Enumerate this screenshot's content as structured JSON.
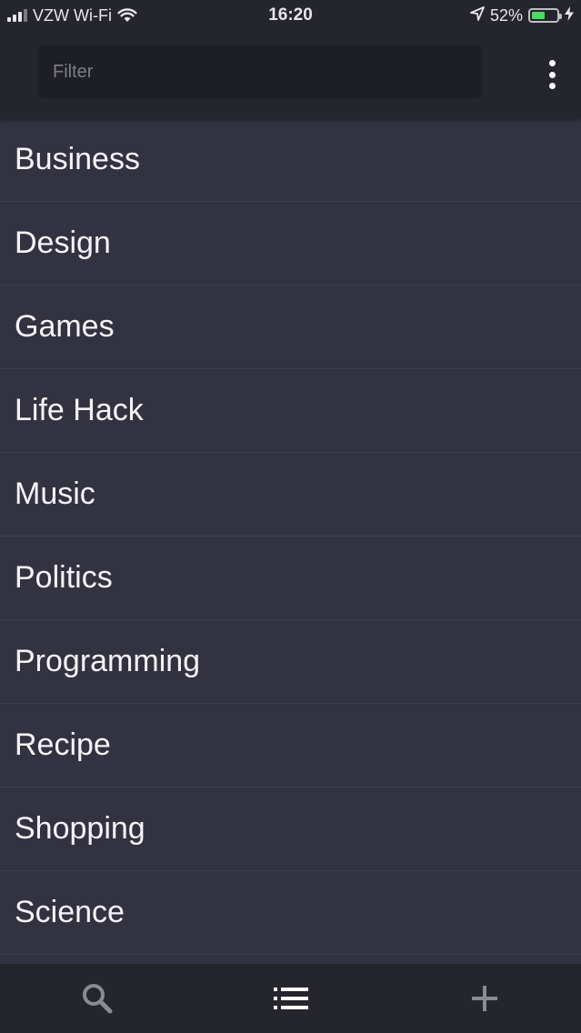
{
  "status_bar": {
    "carrier": "VZW Wi-Fi",
    "time": "16:20",
    "battery_percent": "52%",
    "battery_level": 0.52,
    "icons": [
      "signal-icon",
      "wifi-icon",
      "location-arrow-icon",
      "battery-icon",
      "charging-bolt-icon"
    ]
  },
  "header": {
    "filter_placeholder": "Filter",
    "filter_value": "",
    "menu_icon": "more-vertical-icon"
  },
  "categories": [
    {
      "label": "Business"
    },
    {
      "label": "Design"
    },
    {
      "label": "Games"
    },
    {
      "label": "Life Hack"
    },
    {
      "label": "Music"
    },
    {
      "label": "Politics"
    },
    {
      "label": "Programming"
    },
    {
      "label": "Recipe"
    },
    {
      "label": "Shopping"
    },
    {
      "label": "Science"
    }
  ],
  "tab_bar": {
    "tabs": [
      {
        "icon": "search-icon",
        "active": false
      },
      {
        "icon": "list-icon",
        "active": true
      },
      {
        "icon": "plus-icon",
        "active": false
      }
    ]
  },
  "colors": {
    "background": "#323241",
    "header": "#25252d",
    "input": "#1e1e25",
    "text": "#f4f4f7",
    "battery": "#4cd964",
    "tab_inactive": "#8a8a92",
    "tab_active": "#ffffff"
  }
}
